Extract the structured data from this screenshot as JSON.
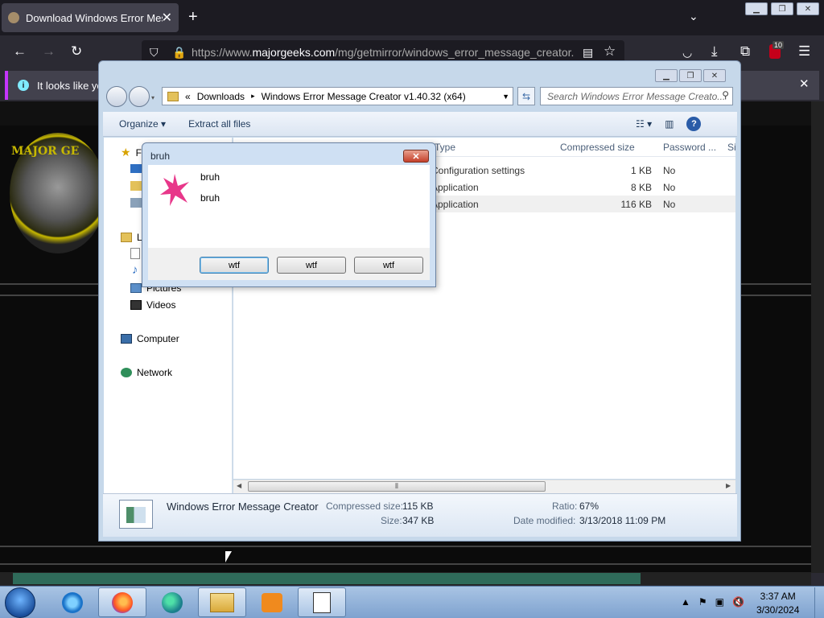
{
  "browser": {
    "tab_title": "Download Windows Error Message Creator",
    "tab_close": "✕",
    "new_tab": "+",
    "url_prefix": "https://www.",
    "url_domain": "majorgeeks.com",
    "url_path": "/mg/getmirror/windows_error_message_creator.",
    "notification_text": "It looks like you",
    "badge_count": "10"
  },
  "page_logo_text": "MAJOR GE",
  "explorer": {
    "breadcrumb": [
      "«",
      "Downloads",
      "▸",
      "Windows Error Message Creator v1.40.32 (x64)"
    ],
    "search_placeholder": "Search Windows Error Message Creato...",
    "toolbar": {
      "organize": "Organize ▾",
      "extract_all": "Extract all files"
    },
    "nav": {
      "favorites": "F",
      "libraries": "L",
      "pictures": "Pictures",
      "videos": "Videos",
      "computer": "Computer",
      "network": "Network"
    },
    "columns": {
      "type": "Type",
      "compressed_size": "Compressed size",
      "password": "Password ...",
      "size": "Si"
    },
    "files": [
      {
        "type": "Configuration settings",
        "compressed": "1 KB",
        "password": "No"
      },
      {
        "type": "Application",
        "compressed": "8 KB",
        "password": "No"
      },
      {
        "type": "Application",
        "compressed": "116 KB",
        "password": "No"
      }
    ],
    "details": {
      "name": "Windows Error Message Creator",
      "compressed_label": "Compressed size:",
      "compressed_value": "115 KB",
      "size_label": "Size:",
      "size_value": "347 KB",
      "ratio_label": "Ratio:",
      "ratio_value": "67%",
      "modified_label": "Date modified:",
      "modified_value": "3/13/2018 11:09 PM"
    }
  },
  "dialog": {
    "title": "bruh",
    "close": "✕",
    "line1": "bruh",
    "line2": "bruh",
    "buttons": [
      "wtf",
      "wtf",
      "wtf"
    ]
  },
  "taskbar": {
    "time": "3:37 AM",
    "date": "3/30/2024"
  }
}
